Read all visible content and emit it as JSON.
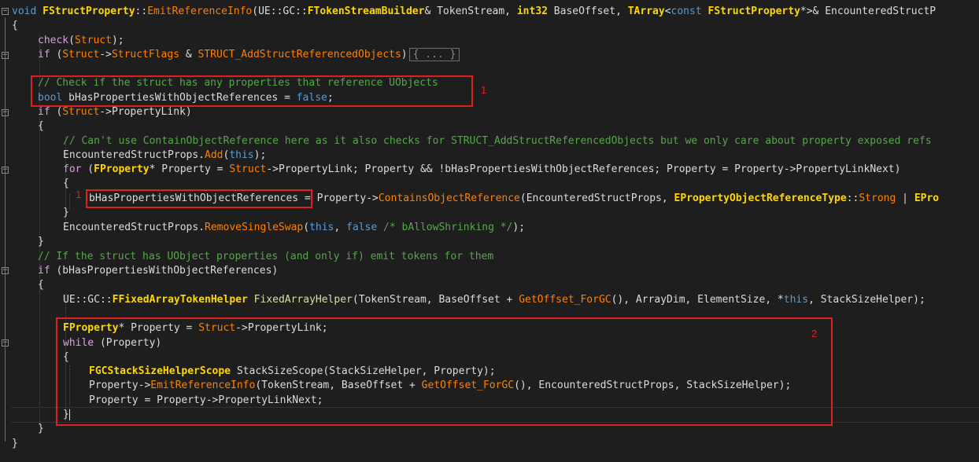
{
  "lines": {
    "l1": {
      "kw": "void",
      "cls": "FStructProperty",
      "sep": "::",
      "fn": "EmitReferenceInfo",
      "rest1": "(UE::GC::",
      "t1": "FTokenStreamBuilder",
      "rest2": "& TokenStream, ",
      "t2": "int32",
      "rest3": " BaseOffset, ",
      "t3": "TArray",
      "rest4": "<",
      "kw2": "const",
      "t4": " FStructProperty",
      "rest5": "*>& EncounteredStructP"
    },
    "l2": "{",
    "l3": {
      "fn": "check",
      "open": "(",
      "arg": "Struct",
      "close": ");"
    },
    "l4": {
      "kw": "if",
      "open": " (",
      "a": "Struct",
      "arrow": "->",
      "b": "StructFlags",
      "amp": " & ",
      "c": "STRUCT_AddStructReferencedObjects",
      "close": ")",
      "collapsed": "{ ... }"
    },
    "l5": {
      "comment": "// Check if the struct has any properties that reference UObjects"
    },
    "l6": {
      "kw": "bool",
      "rest": " bHasPropertiesWithObjectReferences = ",
      "val": "false",
      "end": ";"
    },
    "l7": {
      "kw": "if",
      "open": " (",
      "a": "Struct",
      "arrow": "->",
      "b": "PropertyLink",
      "close": ")"
    },
    "l8": "{",
    "l9": {
      "comment": "// Can't use ContainObjectReference here as it also checks for STRUCT_AddStructReferencedObjects but we only care about property exposed refs"
    },
    "l10": {
      "a": "EncounteredStructProps.",
      "fn": "Add",
      "open": "(",
      "kw": "this",
      "close": ");"
    },
    "l11": {
      "kw": "for",
      "open": " (",
      "t": "FProperty",
      "r1": "* Property = ",
      "s": "Struct",
      "r2": "->PropertyLink; Property && !bHasPropertiesWithObjectReferences; Property = Property->PropertyLinkNext)"
    },
    "l12": "{",
    "l13": {
      "var": "bHasPropertiesWithObjectReferences",
      "r1": " = Property->",
      "fn": "ContainsObjectReference",
      "r2": "(EncounteredStructProps, ",
      "en": "EPropertyObjectReferenceType",
      "sep": "::",
      "m": "Strong",
      "r3": " | ",
      "en2": "EPro"
    },
    "l14": "}",
    "l15": {
      "a": "EncounteredStructProps.",
      "fn": "RemoveSingleSwap",
      "open": "(",
      "kw": "this",
      "comma": ", ",
      "val": "false",
      "comment": " /* bAllowShrinking */",
      "close": ");"
    },
    "l16": "}",
    "l17": {
      "comment": "// If the struct has UObject properties (and only if) emit tokens for them"
    },
    "l18": {
      "kw": "if",
      "rest": " (bHasPropertiesWithObjectReferences)"
    },
    "l19": "{",
    "l20": {
      "ns": "UE::GC::",
      "t": "FFixedArrayTokenHelper",
      "sp": " ",
      "fn": "FixedArrayHelper",
      "r1": "(TokenStream, BaseOffset + ",
      "fn2": "GetOffset_ForGC",
      "r2": "(), ArrayDim, ElementSize, *",
      "kw": "this",
      "r3": ", StackSizeHelper);"
    },
    "l21": {
      "t": "FProperty",
      "r1": "* Property = ",
      "s": "Struct",
      "r2": "->PropertyLink;"
    },
    "l22": {
      "kw": "while",
      "rest": " (Property)"
    },
    "l23": "{",
    "l24": {
      "t": "FGCStackSizeHelperScope",
      "rest": " StackSizeScope(StackSizeHelper, Property);"
    },
    "l25": {
      "a": "Property->",
      "fn": "EmitReferenceInfo",
      "r1": "(TokenStream, BaseOffset + ",
      "fn2": "GetOffset_ForGC",
      "r2": "(), EncounteredStructProps, StackSizeHelper);"
    },
    "l26": {
      "rest": "Property = Property->PropertyLinkNext;"
    },
    "l27": "}",
    "l28": "}",
    "l29": "}"
  },
  "annotations": {
    "box1_label": "1",
    "box1b_label": "1",
    "box2_label": "2"
  }
}
